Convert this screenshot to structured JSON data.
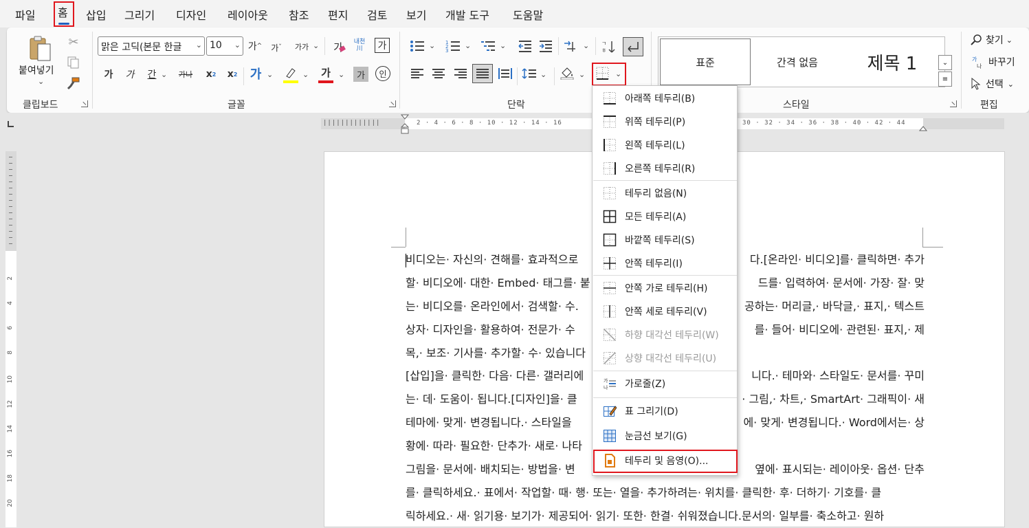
{
  "menu_tabs": [
    "파일",
    "홈",
    "삽입",
    "그리기",
    "디자인",
    "레이아웃",
    "참조",
    "편지",
    "검토",
    "보기",
    "개발 도구",
    "도움말"
  ],
  "ribbon": {
    "clipboard": {
      "group_label": "클립보드",
      "paste_label": "붙여넣기"
    },
    "font": {
      "group_label": "글꼴",
      "font_name": "맑은 고딕(본문 한글",
      "font_size": "10",
      "grow_label": "가",
      "shrink_label": "가",
      "case_label": "가가",
      "bold_label": "가",
      "italic_label": "가",
      "underline_label": "간",
      "strike_label": "가나",
      "subscript_label": "x",
      "superscript_label": "x",
      "text_effect_label": "가",
      "font_color_label": "가",
      "char_shade_label": "가",
      "enclose_label": "인",
      "phonetic_label": "가",
      "ruby_label": "내천",
      "border_char_label": "가"
    },
    "paragraph": {
      "group_label": "단락"
    },
    "styles": {
      "group_label": "스타일",
      "items": [
        "표준",
        "간격 없음",
        "제목 1"
      ]
    },
    "editing": {
      "group_label": "편집",
      "find_label": "찾기",
      "replace_label": "바꾸기",
      "select_label": "선택"
    }
  },
  "colors": {
    "highlight": "#ffff00",
    "font_color": "#e0161d",
    "annotation_red": "#e0161d",
    "accent_blue": "#1f5fbf",
    "icon_orange": "#e07b12"
  },
  "border_menu": {
    "items": [
      {
        "label": "아래쪽 테두리(B)",
        "icon": "bottom-border-icon",
        "enabled": true
      },
      {
        "label": "위쪽 테두리(P)",
        "icon": "top-border-icon",
        "enabled": true
      },
      {
        "label": "왼쪽 테두리(L)",
        "icon": "left-border-icon",
        "enabled": true
      },
      {
        "label": "오른쪽 테두리(R)",
        "icon": "right-border-icon",
        "enabled": true
      },
      {
        "label": "테두리 없음(N)",
        "icon": "no-border-icon",
        "enabled": true
      },
      {
        "label": "모든 테두리(A)",
        "icon": "all-borders-icon",
        "enabled": true
      },
      {
        "label": "바깥쪽 테두리(S)",
        "icon": "outside-borders-icon",
        "enabled": true
      },
      {
        "label": "안쪽 테두리(I)",
        "icon": "inside-borders-icon",
        "enabled": true
      },
      {
        "label": "안쪽 가로 테두리(H)",
        "icon": "inside-horizontal-border-icon",
        "enabled": true
      },
      {
        "label": "안쪽 세로 테두리(V)",
        "icon": "inside-vertical-border-icon",
        "enabled": true
      },
      {
        "label": "하향 대각선 테두리(W)",
        "icon": "diagonal-down-border-icon",
        "enabled": false
      },
      {
        "label": "상향 대각선 테두리(U)",
        "icon": "diagonal-up-border-icon",
        "enabled": false
      },
      {
        "label": "가로줄(Z)",
        "icon": "horizontal-line-icon",
        "enabled": true
      },
      {
        "label": "표 그리기(D)",
        "icon": "draw-table-icon",
        "enabled": true
      },
      {
        "label": "눈금선 보기(G)",
        "icon": "view-gridlines-icon",
        "enabled": true
      },
      {
        "label": "테두리 및 음영(O)...",
        "icon": "borders-shading-icon",
        "enabled": true
      }
    ]
  },
  "document": {
    "paragraphs": [
      [
        "비디오는· 자신의· 견해를· 효과적으로",
        "할· 비디오에· 대한· Embed· 태그를· 붙",
        "는· 비디오를· 온라인에서· 검색할· 수.",
        "상자· 디자인을· 활용하여· 전문가· 수",
        "목,· 보조· 기사를· 추가할· 수· 있습니다"
      ],
      [
        "[삽입]을· 클릭한· 다음· 다른· 갤러리에",
        "는· 데· 도움이· 됩니다.[디자인]을· 클",
        "테마에· 맞게· 변경됩니다.· 스타일을",
        "황에· 따라· 필요한· 단추가· 새로· 나타"
      ],
      [
        "그림을· 문서에· 배치되는· 방법을· 변",
        "를· 클릭하세요.· 표에서· 작업할· 때· 행· 또는· 열을· 추가하려는· 위치를· 클릭한· 후· 더하기· 기호를· 클",
        "릭하세요.· 새· 읽기용· 보기가· 제공되어· 읽기· 또한· 한결· 쉬워졌습니다.문서의· 일부를· 축소하고· 원하"
      ]
    ],
    "right_fragments": [
      [
        "다.[온라인· 비디오]를· 클릭하면· 추가",
        "드를· 입력하여· 문서에· 가장· 잘· 맞",
        "공하는· 머리글,· 바닥글,· 표지,· 텍스트",
        "를· 들어· 비디오에· 관련된· 표지,· 제",
        ""
      ],
      [
        "니다.· 테마와· 스타일도· 문서를· 꾸미",
        "· 그림,· 차트,· SmartArt· 그래픽이· 새",
        "에· 맞게· 변경됩니다.· Word에서는· 상",
        ""
      ],
      [
        "옆에· 표시되는· 레이아웃· 옵션· 단추",
        "",
        ""
      ]
    ]
  },
  "ruler": {
    "h_numbers": "2 · 4 · 6 · 8 · 10 · 12 · 14 · 16",
    "h_numbers_right": "30 · 32 · 34 · 36 · 38 · 40 · 42 · 44",
    "v_numbers": [
      "2",
      "4",
      "6",
      "8",
      "10",
      "12",
      "14",
      "16",
      "18",
      "20"
    ]
  }
}
